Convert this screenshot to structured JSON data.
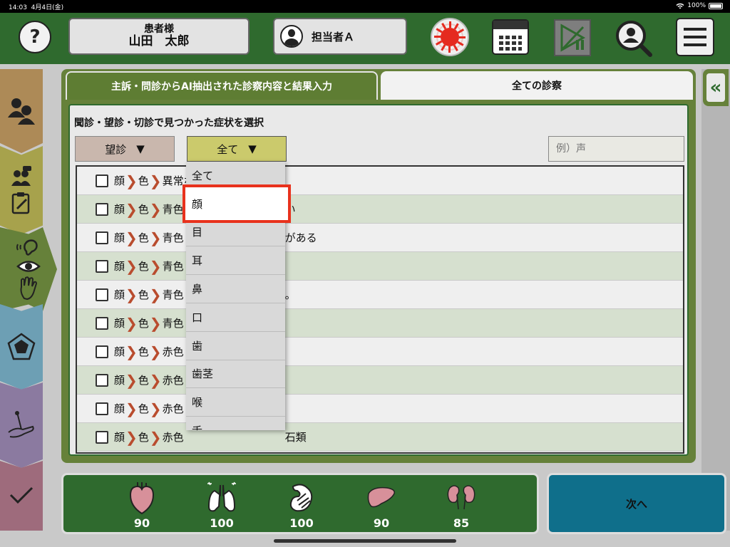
{
  "status_bar": {
    "time": "14:03",
    "date": "4月4日(金)",
    "battery": "100%"
  },
  "header": {
    "help_label": "?",
    "patient_label": "患者様",
    "patient_name": "山田　太郎",
    "staff_name": "担当者Ａ"
  },
  "tabs": [
    {
      "label": "主訴・問診からAI抽出された診察内容と結果入力"
    },
    {
      "label": "全ての診察"
    }
  ],
  "panel": {
    "title": "聞診・望診・切診で見つかった症状を選択",
    "filter1": {
      "value": "望診",
      "arrow": "▼"
    },
    "filter2": {
      "value": "全て",
      "arrow": "▼"
    },
    "search_placeholder": "例）声"
  },
  "rows": [
    {
      "part": "顔",
      "sub": "色",
      "text": "異常な"
    },
    {
      "part": "顔",
      "sub": "色",
      "text": "青色",
      "tail": "い"
    },
    {
      "part": "顔",
      "sub": "色",
      "text": "青色",
      "tail": "がある"
    },
    {
      "part": "顔",
      "sub": "色",
      "text": "青色"
    },
    {
      "part": "顔",
      "sub": "色",
      "text": "青色",
      "tail": "。"
    },
    {
      "part": "顔",
      "sub": "色",
      "text": "青色"
    },
    {
      "part": "顔",
      "sub": "色",
      "text": "赤色"
    },
    {
      "part": "顔",
      "sub": "色",
      "text": "赤色"
    },
    {
      "part": "顔",
      "sub": "色",
      "text": "赤色"
    },
    {
      "part": "顔",
      "sub": "色",
      "text": "赤色",
      "tail": "石類"
    }
  ],
  "dropdown": {
    "items": [
      "全て",
      "顔",
      "目",
      "耳",
      "鼻",
      "口",
      "歯",
      "歯茎",
      "喉",
      "舌"
    ],
    "selected": "顔"
  },
  "footer": {
    "organs": [
      {
        "icon": "heart-icon",
        "value": "90"
      },
      {
        "icon": "lungs-icon",
        "value": "100"
      },
      {
        "icon": "stomach-icon",
        "value": "100"
      },
      {
        "icon": "liver-icon",
        "value": "90"
      },
      {
        "icon": "kidneys-icon",
        "value": "85"
      }
    ],
    "next_label": "次へ"
  },
  "colors": {
    "header": "#2f6a2e",
    "tab_active": "#66813a",
    "highlight": "#e8321d",
    "next": "#0f6f8b"
  }
}
